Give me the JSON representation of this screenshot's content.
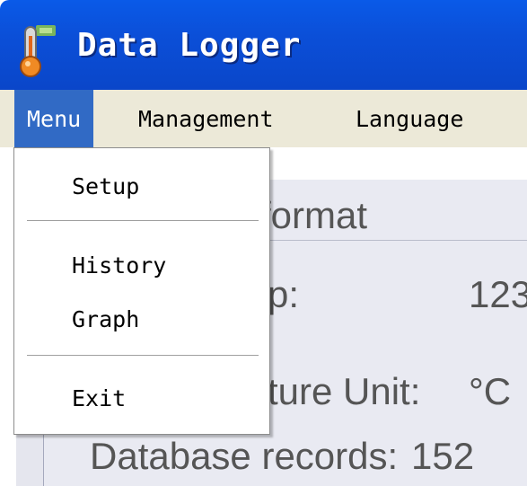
{
  "window": {
    "title": "Data Logger",
    "icon": "thermometer-icon"
  },
  "menubar": {
    "items": [
      {
        "label": "Menu",
        "active": true
      },
      {
        "label": "Management"
      },
      {
        "label": "Language"
      }
    ]
  },
  "dropdown": {
    "items": [
      {
        "label": "Setup"
      },
      {
        "label": "History"
      },
      {
        "label": "Graph"
      },
      {
        "label": "Exit"
      }
    ]
  },
  "content": {
    "group_title_partial": "format",
    "rows": [
      {
        "label_partial": "p:",
        "value_partial": "123"
      },
      {
        "label_partial": "ture Unit:",
        "value": "°C"
      },
      {
        "label": "Database records:",
        "value_partial": "152"
      }
    ]
  },
  "colors": {
    "titlebar": "#0b4fd8",
    "menu_active": "#316ac5",
    "menubar": "#ece9d8"
  }
}
